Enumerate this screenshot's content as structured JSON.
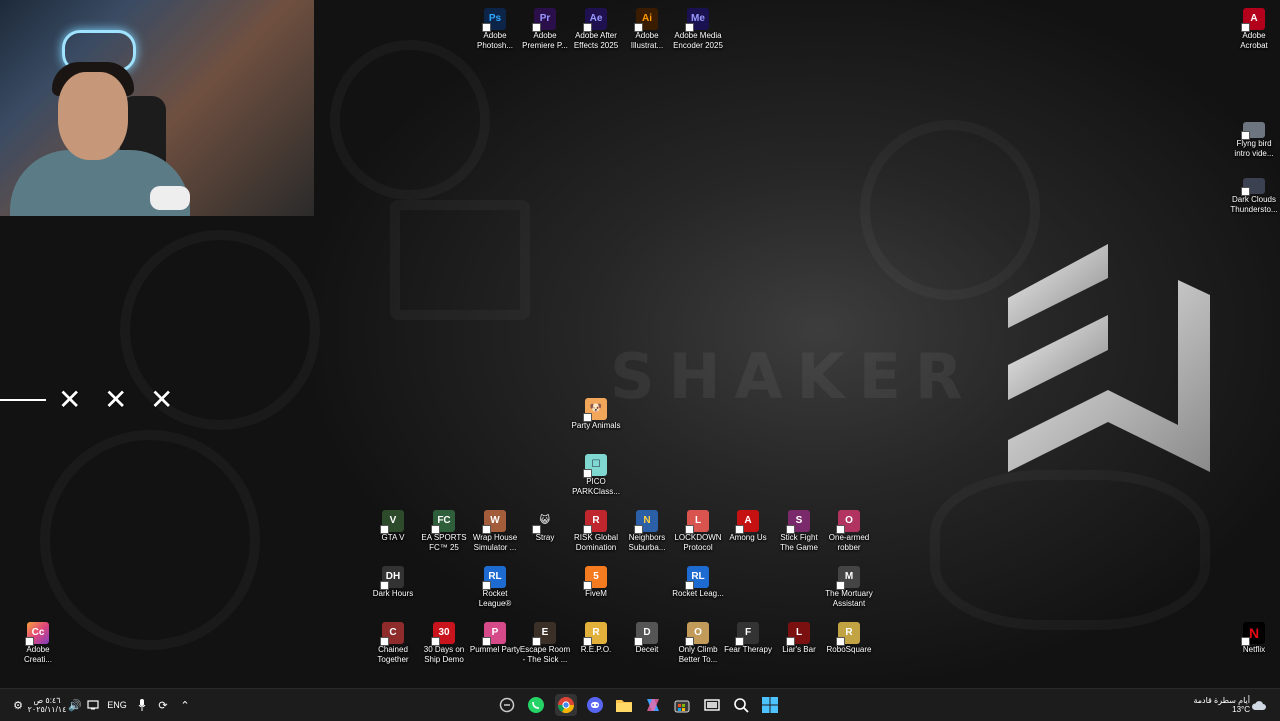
{
  "desktop": {
    "watermark": "SHAKER",
    "top_icons": [
      {
        "label": "Adobe Photosh...",
        "badge": "Ps",
        "color": "#0b2447"
      },
      {
        "label": "Adobe Premiere P...",
        "badge": "Pr",
        "color": "#2a0f4a"
      },
      {
        "label": "Adobe After Effects 2025",
        "badge": "Ae",
        "color": "#1f1150"
      },
      {
        "label": "Adobe Illustrat...",
        "badge": "Ai",
        "color": "#3a1c00"
      },
      {
        "label": "Adobe Media Encoder 2025",
        "badge": "Me",
        "color": "#1a1150"
      }
    ],
    "right_icons": [
      {
        "label": "Adobe Acrobat",
        "badge": "A",
        "color": "#b3001b"
      },
      {
        "label": "Flyng bird intro vide...",
        "badge": "",
        "color": "#6d7680"
      },
      {
        "label": "Dark Clouds Thundersto...",
        "badge": "",
        "color": "#3b4150"
      },
      {
        "label": "Netflix",
        "badge": "N",
        "color": "#000000"
      }
    ],
    "left_icons": [
      {
        "label": "Adobe Creati...",
        "badge": "Cc",
        "color": "#e0457b"
      }
    ],
    "center_icons": [
      {
        "label": "Party Animals",
        "badge": "🐶",
        "color": "#f2a65a"
      },
      {
        "label": "PICO PARKClass...",
        "badge": "☐",
        "color": "#7fd9d0"
      }
    ],
    "row1": [
      {
        "label": "GTA V",
        "badge": "V",
        "color": "#2d4a2a"
      },
      {
        "label": "EA SPORTS FC™ 25",
        "badge": "FC",
        "color": "#2f5f3a"
      },
      {
        "label": "Wrap House Simulator ...",
        "badge": "W",
        "color": "#a35d3b"
      },
      {
        "label": "Stray",
        "badge": "😺",
        "color": "#dddddd"
      },
      {
        "label": "RISK Global Domination",
        "badge": "R",
        "color": "#c0262d"
      },
      {
        "label": "Neighbors Suburba...",
        "badge": "N",
        "color": "#2b5fa8"
      },
      {
        "label": "LOCKDOWN Protocol",
        "badge": "L",
        "color": "#d9534f"
      },
      {
        "label": "Among Us",
        "badge": "A",
        "color": "#c51111"
      },
      {
        "label": "Stick Fight The Game",
        "badge": "S",
        "color": "#7a2a6a"
      },
      {
        "label": "One-armed robber",
        "badge": "O",
        "color": "#b0345f"
      }
    ],
    "row2": [
      {
        "label": "Dark Hours",
        "badge": "DH",
        "color": "#333333"
      },
      {
        "label": "Rocket League®",
        "badge": "RL",
        "color": "#1d6bd1"
      },
      {
        "label": "FiveM",
        "badge": "5",
        "color": "#f47b20"
      },
      {
        "label": "Rocket Leag...",
        "badge": "RL",
        "color": "#1d6bd1"
      },
      {
        "label": "The Mortuary Assistant",
        "badge": "M",
        "color": "#444444"
      }
    ],
    "row3": [
      {
        "label": "Chained Together",
        "badge": "C",
        "color": "#8e2b2b"
      },
      {
        "label": "30 Days on Ship Demo",
        "badge": "30",
        "color": "#c9141d"
      },
      {
        "label": "Pummel Party",
        "badge": "P",
        "color": "#d64a8a"
      },
      {
        "label": "Escape Room - The Sick ...",
        "badge": "E",
        "color": "#3b3027"
      },
      {
        "label": "R.E.P.O.",
        "badge": "R",
        "color": "#e2b13c"
      },
      {
        "label": "Deceit",
        "badge": "D",
        "color": "#555555"
      },
      {
        "label": "Only Climb Better To...",
        "badge": "O",
        "color": "#c29a5a"
      },
      {
        "label": "Fear Therapy",
        "badge": "F",
        "color": "#333333"
      },
      {
        "label": "Liar's Bar",
        "badge": "L",
        "color": "#7a1010"
      },
      {
        "label": "RoboSquare",
        "badge": "R",
        "color": "#c2a344"
      }
    ]
  },
  "taskbar": {
    "time": "٥:٤٦ ص",
    "date": "٢٠٢٥/١١/١٤",
    "language": "ENG",
    "weather_text": "أيام سطرة قادمة",
    "temperature": "13°C",
    "apps": [
      "copilot-icon",
      "whatsapp-icon",
      "chrome-icon",
      "discord-icon",
      "file-explorer-icon",
      "copilot-app-icon",
      "store-icon",
      "task-view-icon",
      "search-icon",
      "start-icon"
    ]
  }
}
